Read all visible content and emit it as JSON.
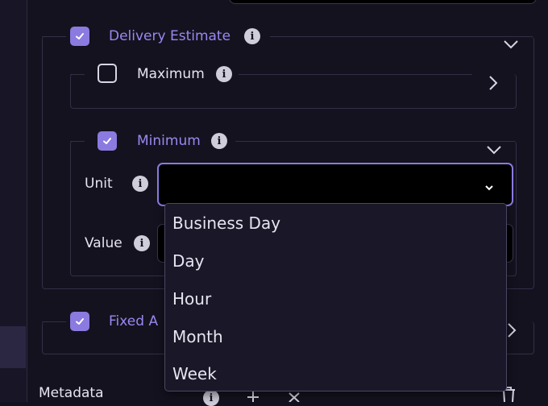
{
  "delivery_estimate": {
    "label": "Delivery Estimate",
    "checked": true
  },
  "maximum": {
    "label": "Maximum",
    "checked": false
  },
  "minimum": {
    "label": "Minimum",
    "checked": true,
    "unit_label": "Unit",
    "unit_value": "",
    "value_label": "Value"
  },
  "fixed": {
    "label": "Fixed A",
    "checked": true
  },
  "metadata": {
    "label": "Metadata"
  },
  "dropdown": {
    "options": [
      "Business Day",
      "Day",
      "Hour",
      "Month",
      "Week"
    ]
  },
  "colors": {
    "accent": "#8b7ae0",
    "background": "#14121f",
    "border": "#332f48"
  },
  "icons": {
    "info": "i"
  }
}
